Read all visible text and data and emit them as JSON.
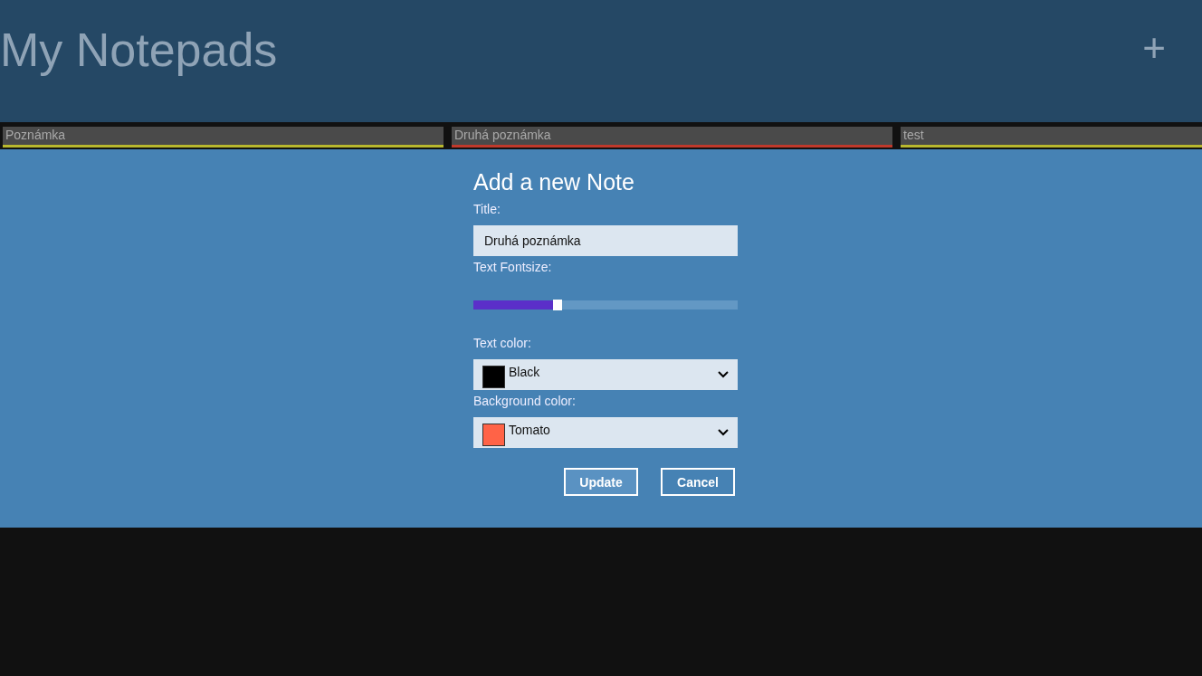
{
  "header": {
    "title": "My Notepads",
    "add_button": "+"
  },
  "notes": [
    {
      "title": "Poznámka",
      "color": "#b8b82e"
    },
    {
      "title": "Druhá poznámka",
      "color": "#c0392b"
    },
    {
      "title": "test",
      "color": "#b8b82e"
    }
  ],
  "dialog": {
    "title": "Add a new Note",
    "title_label": "Title:",
    "title_value": "Druhá poznámka",
    "fontsize_label": "Text Fontsize:",
    "fontsize": {
      "level": 0.3
    },
    "text_color_label": "Text color:",
    "text_color": {
      "name": "Black",
      "color": "#000000"
    },
    "background_color_label": "Background color:",
    "background_color": {
      "name": "Tomato",
      "color": "#ff6347"
    },
    "buttons": [
      "Update",
      "Cancel"
    ]
  }
}
